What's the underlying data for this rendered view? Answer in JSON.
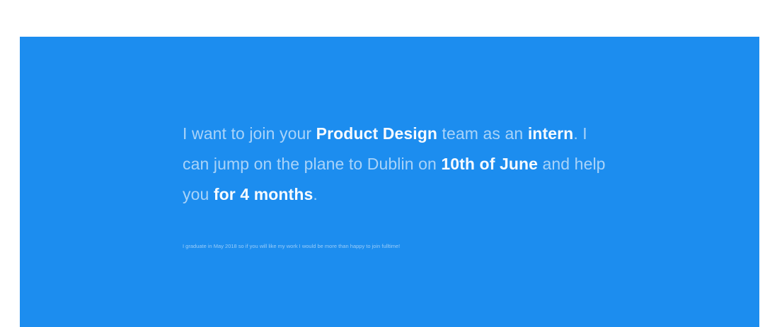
{
  "colors": {
    "page_background": "#ffffff",
    "panel_background": "#1c8def",
    "text_muted": "rgba(255,255,255,0.62)",
    "text_highlight": "#ffffff"
  },
  "message": {
    "segments": [
      {
        "text": "I want to join your ",
        "highlight": false
      },
      {
        "text": "Product Design",
        "highlight": true
      },
      {
        "text": " team as an ",
        "highlight": false
      },
      {
        "text": "intern",
        "highlight": true
      },
      {
        "text": ". I can jump on the plane to Dublin on ",
        "highlight": false
      },
      {
        "text": "10th of June",
        "highlight": true
      },
      {
        "text": " and help you ",
        "highlight": false
      },
      {
        "text": "for 4 months",
        "highlight": true
      },
      {
        "text": ".",
        "highlight": false
      }
    ]
  },
  "footnote": {
    "text": "I graduate in May 2018 so if you will like my work I would be more than happy to join fulltime!"
  }
}
